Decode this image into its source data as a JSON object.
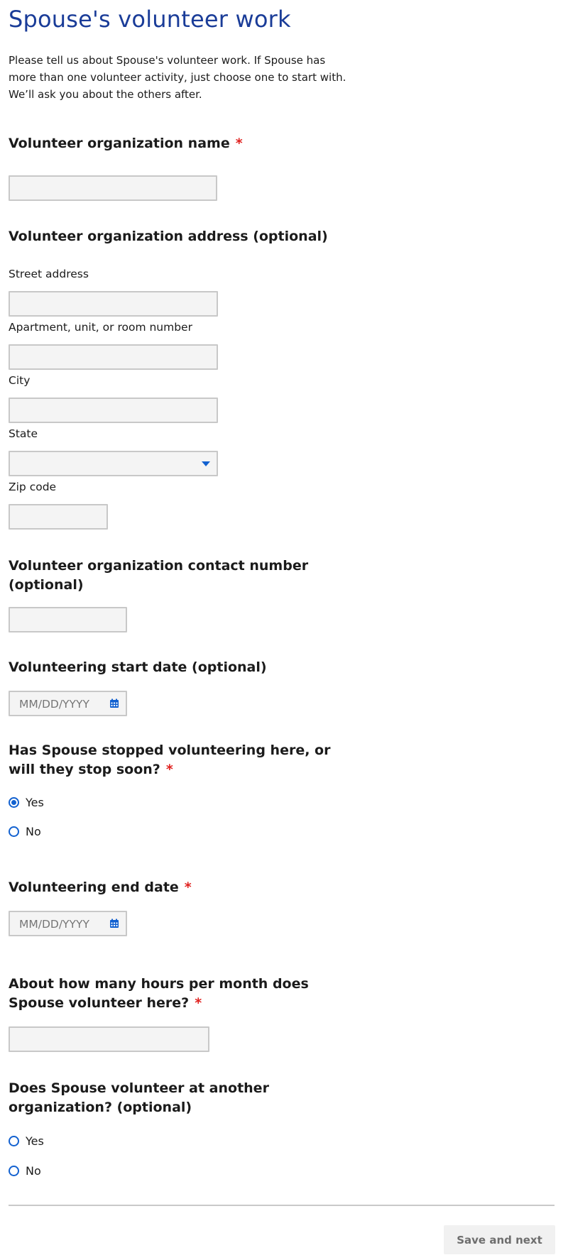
{
  "page": {
    "title": "Spouse's volunteer work",
    "intro": "Please tell us about Spouse's volunteer work. If Spouse has more than one volunteer activity, just choose one to start with. We’ll ask you about the others after."
  },
  "org_name": {
    "label": "Volunteer organization name",
    "required_mark": "*",
    "value": ""
  },
  "address": {
    "label": "Volunteer organization address (optional)",
    "street_label": "Street address",
    "street_value": "",
    "apt_label": "Apartment, unit, or room number",
    "apt_value": "",
    "city_label": "City",
    "city_value": "",
    "state_label": "State",
    "state_value": "",
    "zip_label": "Zip code",
    "zip_value": ""
  },
  "contact": {
    "label": "Volunteer organization contact number (optional)",
    "value": ""
  },
  "start_date": {
    "label": "Volunteering start date (optional)",
    "placeholder": "MM/DD/YYYY",
    "icon": "calendar-icon"
  },
  "stopped": {
    "label": "Has Spouse stopped volunteering here, or will they stop soon?",
    "required_mark": "*",
    "options": [
      "Yes",
      "No"
    ],
    "selected": "Yes"
  },
  "end_date": {
    "label": "Volunteering end date",
    "required_mark": "*",
    "placeholder": "MM/DD/YYYY",
    "icon": "calendar-icon"
  },
  "hours": {
    "label": "About how many hours per month does Spouse volunteer here?",
    "required_mark": "*",
    "value": ""
  },
  "another": {
    "label": "Does Spouse volunteer at another organization? (optional)",
    "options": [
      "Yes",
      "No"
    ],
    "selected": null
  },
  "actions": {
    "save_next": "Save and next"
  },
  "colors": {
    "title": "#1a3c98",
    "accent": "#1261d0",
    "required": "#e0211f",
    "input_bg": "#f4f4f4"
  }
}
